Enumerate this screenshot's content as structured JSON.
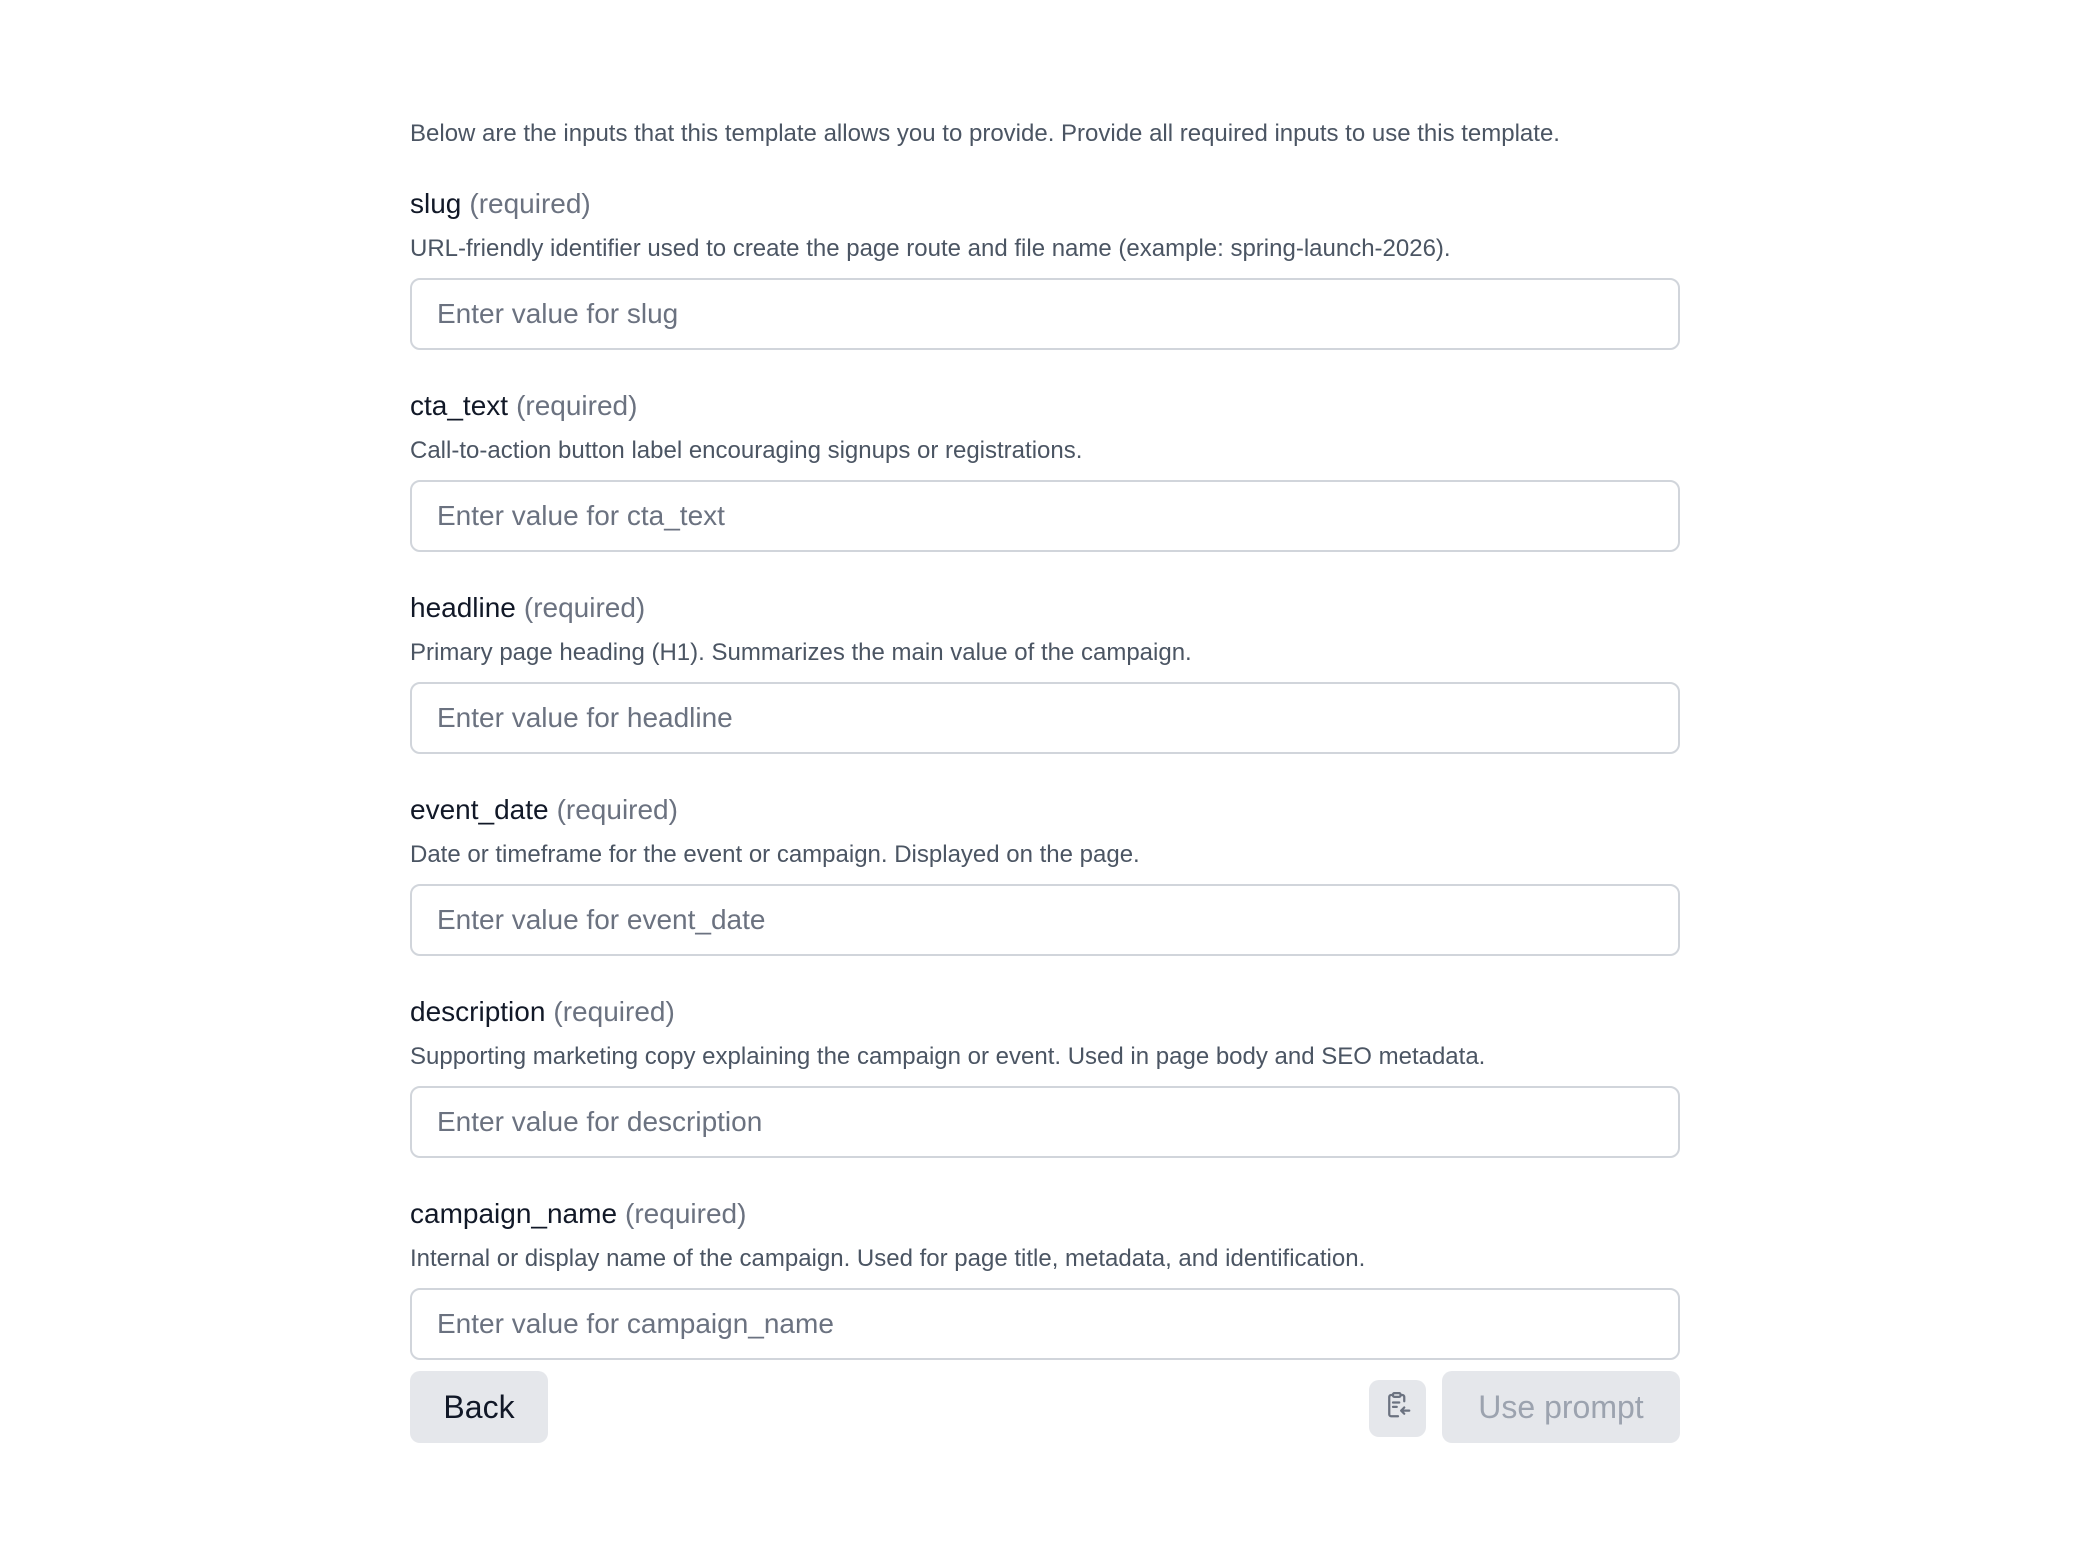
{
  "intro": "Below are the inputs that this template allows you to provide. Provide all required inputs to use this template.",
  "required_marker": "(required)",
  "fields": [
    {
      "name": "slug",
      "help": "URL-friendly identifier used to create the page route and file name (example: spring-launch-2026).",
      "placeholder": "Enter value for slug",
      "value": ""
    },
    {
      "name": "cta_text",
      "help": "Call-to-action button label encouraging signups or registrations.",
      "placeholder": "Enter value for cta_text",
      "value": ""
    },
    {
      "name": "headline",
      "help": "Primary page heading (H1). Summarizes the main value of the campaign.",
      "placeholder": "Enter value for headline",
      "value": ""
    },
    {
      "name": "event_date",
      "help": "Date or timeframe for the event or campaign. Displayed on the page.",
      "placeholder": "Enter value for event_date",
      "value": ""
    },
    {
      "name": "description",
      "help": "Supporting marketing copy explaining the campaign or event. Used in page body and SEO metadata.",
      "placeholder": "Enter value for description",
      "value": ""
    },
    {
      "name": "campaign_name",
      "help": "Internal or display name of the campaign. Used for page title, metadata, and identification.",
      "placeholder": "Enter value for campaign_name",
      "value": ""
    }
  ],
  "actions": {
    "back_label": "Back",
    "copy_icon": "clipboard-import-icon",
    "use_label": "Use prompt"
  },
  "colors": {
    "button_bg": "#e5e7eb",
    "disabled_text": "#9ca3af",
    "border": "#d1d5db",
    "muted_text": "#4b5563"
  }
}
